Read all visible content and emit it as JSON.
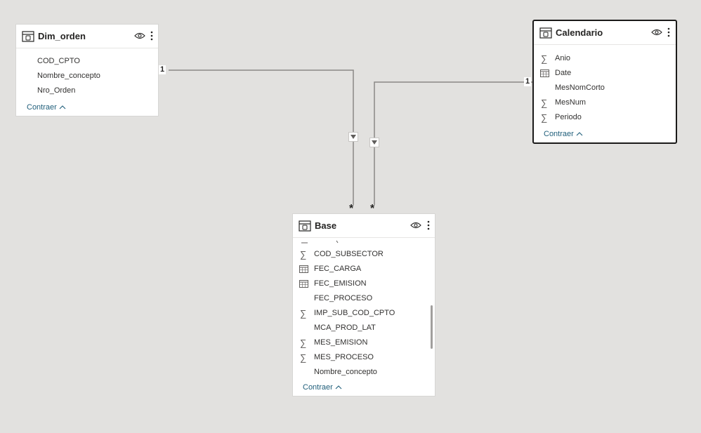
{
  "colors": {
    "canvas": "#e2e1df",
    "card": "#ffffff",
    "link": "#1f5e7a",
    "line": "#8a8886"
  },
  "tables": {
    "dim_orden": {
      "title": "Dim_orden",
      "fields": [
        {
          "name": "COD_CPTO",
          "icon": ""
        },
        {
          "name": "Nombre_concepto",
          "icon": ""
        },
        {
          "name": "Nro_Orden",
          "icon": ""
        }
      ],
      "collapse_label": "Contraer"
    },
    "calendario": {
      "title": "Calendario",
      "fields": [
        {
          "name": "Anio",
          "icon": "sigma-icon"
        },
        {
          "name": "Date",
          "icon": "calendar-icon"
        },
        {
          "name": "MesNomCorto",
          "icon": ""
        },
        {
          "name": "MesNum",
          "icon": "sigma-icon"
        },
        {
          "name": "Periodo",
          "icon": "sigma-icon"
        }
      ],
      "collapse_label": "Contraer"
    },
    "base": {
      "title": "Base",
      "fields": [
        {
          "name": "COD_SUBSECTOR",
          "icon": "sigma-icon"
        },
        {
          "name": "FEC_CARGA",
          "icon": "calendar-icon"
        },
        {
          "name": "FEC_EMISION",
          "icon": "calendar-icon"
        },
        {
          "name": "FEC_PROCESO",
          "icon": ""
        },
        {
          "name": "IMP_SUB_COD_CPTO",
          "icon": "sigma-icon"
        },
        {
          "name": "MCA_PROD_LAT",
          "icon": ""
        },
        {
          "name": "MES_EMISION",
          "icon": "sigma-icon"
        },
        {
          "name": "MES_PROCESO",
          "icon": "sigma-icon"
        },
        {
          "name": "Nombre_concepto",
          "icon": ""
        }
      ],
      "collapse_label": "Contraer"
    }
  },
  "relationships": {
    "one_label": "1",
    "many_label": "*"
  }
}
